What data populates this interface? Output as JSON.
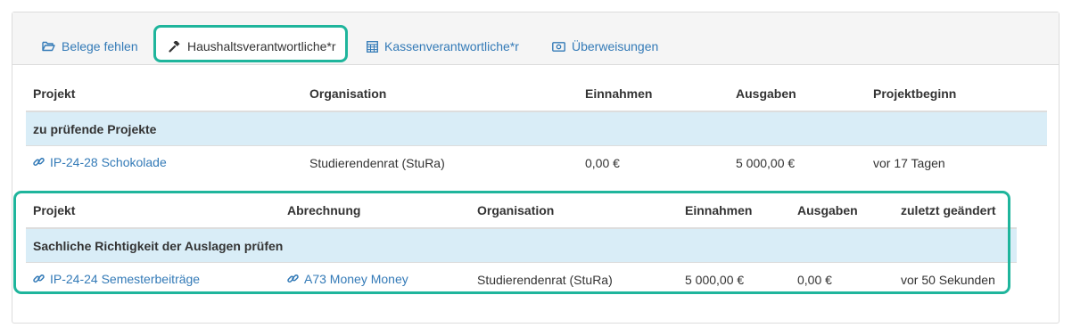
{
  "tabs": [
    {
      "label": "Belege fehlen",
      "icon": "folder-open-icon"
    },
    {
      "label": "Haushaltsverantwortliche*r",
      "icon": "gavel-icon",
      "active": true
    },
    {
      "label": "Kassenverantwortliche*r",
      "icon": "calculator-icon"
    },
    {
      "label": "Überweisungen",
      "icon": "money-icon"
    }
  ],
  "table1": {
    "headers": [
      "Projekt",
      "Organisation",
      "Einnahmen",
      "Ausgaben",
      "Projektbeginn"
    ],
    "group_label": "zu prüfende Projekte",
    "rows": [
      {
        "projekt": "IP-24-28 Schokolade",
        "organisation": "Studierendenrat (StuRa)",
        "einnahmen": "0,00 €",
        "ausgaben": "5 000,00 €",
        "beginn": "vor 17 Tagen"
      }
    ]
  },
  "table2": {
    "headers": [
      "Projekt",
      "Abrechnung",
      "Organisation",
      "Einnahmen",
      "Ausgaben",
      "zuletzt geändert"
    ],
    "group_label": "Sachliche Richtigkeit der Auslagen prüfen",
    "rows": [
      {
        "projekt": "IP-24-24 Semesterbeiträge",
        "abrechnung": "A73 Money Money",
        "organisation": "Studierendenrat (StuRa)",
        "einnahmen": "5 000,00 €",
        "ausgaben": "0,00 €",
        "geaendert": "vor 50 Sekunden"
      }
    ]
  },
  "colors": {
    "accent": "#1fb59c",
    "link": "#337ab7",
    "group_bg": "#d9edf7"
  }
}
